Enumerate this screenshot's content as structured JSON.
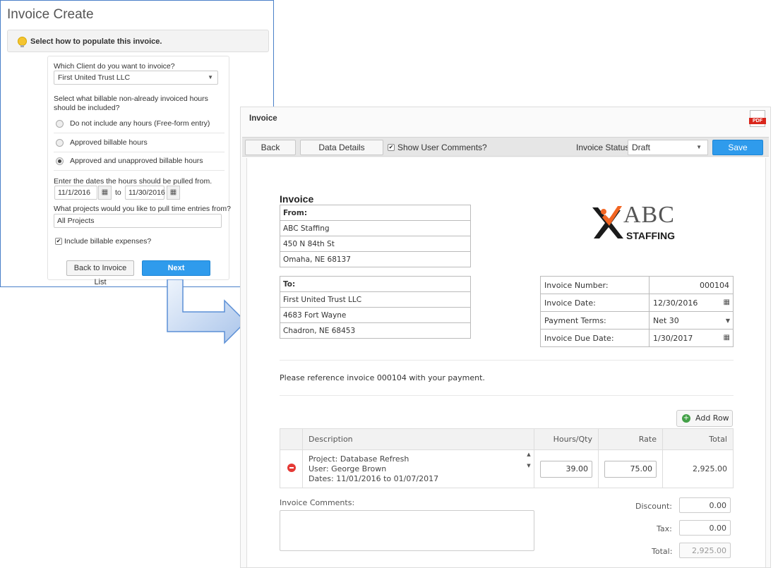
{
  "wizard": {
    "title": "Invoice Create",
    "hint": "Select how to populate this invoice.",
    "client_question": "Which Client do you want to invoice?",
    "client_value": "First United Trust LLC",
    "hours_question": "Select what billable non-already invoiced hours should be included?",
    "hours_options": [
      {
        "label": "Do not include any hours (Free-form entry)",
        "selected": false
      },
      {
        "label": "Approved billable hours",
        "selected": false
      },
      {
        "label": "Approved and unapproved billable hours",
        "selected": true
      }
    ],
    "dates_question": "Enter the dates the hours should be pulled from.",
    "date_from": "11/1/2016",
    "date_to_label": "to",
    "date_to": "11/30/2016",
    "projects_question": "What projects would you like to pull time entries from?",
    "projects_value": "All Projects",
    "include_expenses_label": "Include billable expenses?",
    "include_expenses_checked": true,
    "back_button": "Back to Invoice List",
    "next_button": "Next"
  },
  "invoice": {
    "window_title": "Invoice",
    "pdf_label": "PDF",
    "toolbar": {
      "back": "Back",
      "data_details": "Data Details",
      "show_comments_label": "Show User Comments?",
      "show_comments_checked": true,
      "status_label": "Invoice Status:",
      "status_value": "Draft",
      "save": "Save"
    },
    "doc_title": "Invoice",
    "from": {
      "heading": "From:",
      "lines": [
        "ABC Staffing",
        "450 N 84th St",
        "Omaha, NE 68137"
      ]
    },
    "to": {
      "heading": "To:",
      "lines": [
        "First United Trust LLC",
        "4683 Fort Wayne",
        "Chadron, NE 68453"
      ]
    },
    "logo": {
      "big": "ABC",
      "small": "STAFFING",
      "accent_color": "#f26522"
    },
    "meta": {
      "number_label": "Invoice Number:",
      "number_value": "000104",
      "date_label": "Invoice Date:",
      "date_value": "12/30/2016",
      "terms_label": "Payment Terms:",
      "terms_value": "Net 30",
      "due_label": "Invoice Due Date:",
      "due_value": "1/30/2017"
    },
    "reference_note": "Please reference invoice 000104 with your payment.",
    "add_row": "Add Row",
    "columns": {
      "description": "Description",
      "hours": "Hours/Qty",
      "rate": "Rate",
      "total": "Total"
    },
    "line": {
      "desc1": "Project: Database Refresh",
      "desc2": "User: George Brown",
      "desc3": "Dates: 11/01/2016 to 01/07/2017",
      "hours": "39.00",
      "rate": "75.00",
      "total": "2,925.00"
    },
    "comments_label": "Invoice Comments:",
    "discount_label": "Discount:",
    "discount_value": "0.00",
    "tax_label": "Tax:",
    "tax_value": "0.00",
    "total_label": "Total:",
    "total_value": "2,925.00"
  }
}
